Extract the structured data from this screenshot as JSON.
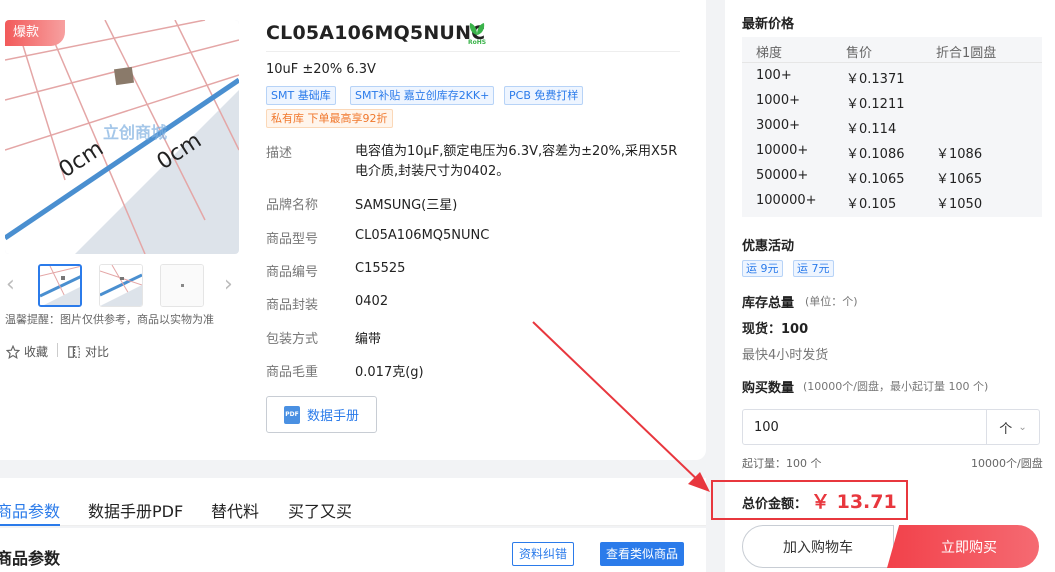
{
  "product": {
    "hot_badge": "爆款",
    "title": "CL05A106MQ5NUNC",
    "rohs_label": "RoHS",
    "spec_line": "10uF ±20% 6.3V",
    "tags": [
      "SMT  基础库",
      "SMT补贴  嘉立创库存2KK+",
      "PCB  免费打样"
    ],
    "private_tag": "私有库  下单最高享92折",
    "image_watermark": "立创商城",
    "image_scale_labels": [
      "0cm",
      "0cm"
    ],
    "thumb_tip": "温馨提醒：图片仅供参考，商品以实物为准",
    "favorite_label": "收藏",
    "compare_label": "对比",
    "attributes": {
      "desc_label": "描述",
      "desc_value": "电容值为10μF,额定电压为6.3V,容差为±20%,采用X5R电介质,封装尺寸为0402。",
      "brand_label": "品牌名称",
      "brand_value": "SAMSUNG(三星)",
      "model_label": "商品型号",
      "model_value": "CL05A106MQ5NUNC",
      "code_label": "商品编号",
      "code_value": "C15525",
      "package_label": "商品封装",
      "package_value": "0402",
      "packing_label": "包装方式",
      "packing_value": "编带",
      "weight_label": "商品毛重",
      "weight_value": "0.017克(g)"
    },
    "datasheet_button": "数据手册",
    "pdf_icon_text": "PDF"
  },
  "tabs": [
    "商品参数",
    "数据手册PDF",
    "替代料",
    "买了又买"
  ],
  "params_section": {
    "title": "商品参数",
    "report_button": "资料纠错",
    "similar_button": "查看类似商品"
  },
  "pricing": {
    "title": "最新价格",
    "headers": [
      "梯度",
      "售价",
      "折合1圆盘"
    ],
    "rows": [
      {
        "qty": "100+",
        "price": "￥0.1371",
        "reel": ""
      },
      {
        "qty": "1000+",
        "price": "￥0.1211",
        "reel": ""
      },
      {
        "qty": "3000+",
        "price": "￥0.114",
        "reel": ""
      },
      {
        "qty": "10000+",
        "price": "￥0.1086",
        "reel": "￥1086"
      },
      {
        "qty": "50000+",
        "price": "￥0.1065",
        "reel": "￥1065"
      },
      {
        "qty": "100000+",
        "price": "￥0.105",
        "reel": "￥1050"
      }
    ]
  },
  "promo": {
    "title": "优惠活动",
    "tags": [
      "运  9元",
      "运  7元"
    ]
  },
  "stock": {
    "title": "库存总量",
    "unit_note": "(单位：个)",
    "in_stock": "现货：100",
    "ship_time": "最快4小时发货"
  },
  "purchase": {
    "title": "购买数量",
    "note": "(10000个/圆盘，最小起订量 100 个)",
    "qty_value": "100",
    "unit": "个",
    "min_order": "起订量：100 个",
    "per_reel": "10000个/圆盘",
    "total_label": "总价金额：",
    "total_value": "￥ 13.71",
    "add_cart": "加入购物车",
    "buy_now": "立即购买"
  },
  "colors": {
    "accent": "#2b7bea",
    "price_red": "#e8373e",
    "hot_badge": "#f25a5a",
    "private_orange": "#f0782d"
  }
}
